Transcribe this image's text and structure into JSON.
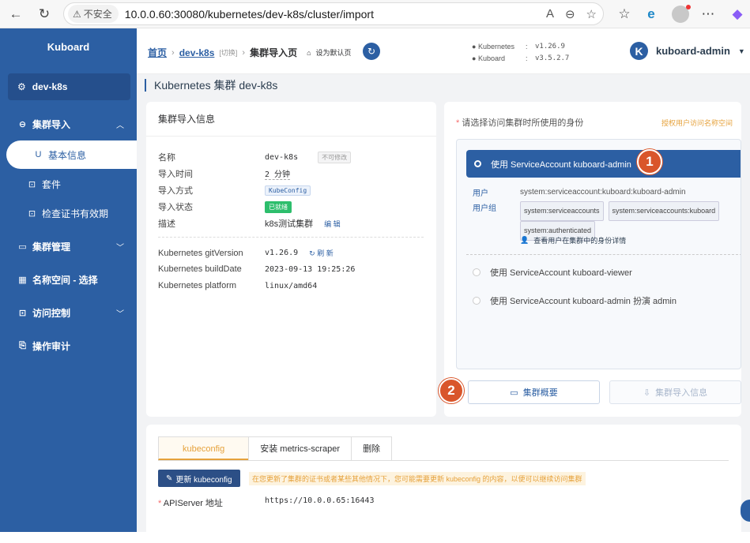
{
  "browser": {
    "security": "不安全",
    "url": "10.0.0.60:30080/kubernetes/dev-k8s/cluster/import"
  },
  "sidebar": {
    "brand": "Kuboard",
    "cluster": "dev-k8s",
    "items": [
      {
        "label": "集群导入"
      },
      {
        "label": "基本信息"
      },
      {
        "label": "套件"
      },
      {
        "label": "检查证书有效期"
      },
      {
        "label": "集群管理"
      },
      {
        "label": "名称空间 - 选择"
      },
      {
        "label": "访问控制"
      },
      {
        "label": "操作审计"
      }
    ]
  },
  "header": {
    "crumbs": {
      "home": "首页",
      "cluster": "dev-k8s",
      "switch": "[切换]",
      "current": "集群导入页",
      "set_default": "设为默认页"
    },
    "versions": {
      "k8s_label": "Kubernetes",
      "k8s": "v1.26.9",
      "kuboard_label": "Kuboard",
      "kuboard": "v3.5.2.7",
      "colon": ":"
    },
    "user": {
      "initial": "K",
      "name": "kuboard-admin"
    }
  },
  "page": {
    "title": "Kubernetes 集群 dev-k8s"
  },
  "info": {
    "title": "集群导入信息",
    "name_k": "名称",
    "name_v": "dev-k8s",
    "name_tag": "不可修改",
    "time_k": "导入时间",
    "time_v": "2 分钟",
    "method_k": "导入方式",
    "method_v": "KubeConfig",
    "status_k": "导入状态",
    "status_v": "已就绪",
    "desc_k": "描述",
    "desc_v": "k8s测试集群",
    "edit": "编 辑",
    "git_k": "Kubernetes gitVersion",
    "git_v": "v1.26.9",
    "refresh": "刷 新",
    "build_k": "Kubernetes buildDate",
    "build_v": "2023-09-13 19:25:26",
    "platform_k": "Kubernetes platform",
    "platform_v": "linux/amd64"
  },
  "identity": {
    "label": "请选择访问集群时所使用的身份",
    "auth_link": "授权用户访问名称空间",
    "selected": "使用 ServiceAccount kuboard-admin",
    "user_k": "用户",
    "user_v": "system:serviceaccount:kuboard:kuboard-admin",
    "group_k": "用户组",
    "groups": [
      "system:serviceaccounts",
      "system:serviceaccounts:kuboard",
      "system:authenticated"
    ],
    "detail_link": "查看用户在集群中的身份详情",
    "option2": "使用 ServiceAccount kuboard-viewer",
    "option3": "使用 ServiceAccount kuboard-admin 扮演 admin",
    "badge1": "1",
    "badge2": "2",
    "btn_overview": "集群概要",
    "btn_import": "集群导入信息"
  },
  "bottom": {
    "tabs": [
      "kubeconfig",
      "安装 metrics-scraper",
      "删除"
    ],
    "update_btn": "更新 kubeconfig",
    "note": "在您更新了集群的证书或者某些其他情况下，您可能需要更新 kubeconfig 的内容，以便可以继续访问集群",
    "api_k": "APIServer 地址",
    "api_v": "https://10.0.0.65:16443"
  },
  "colors": {
    "primary": "#2c5fa3",
    "badge": "#d9562b",
    "warning": "#e6a23c",
    "success": "#2dbe6c"
  }
}
